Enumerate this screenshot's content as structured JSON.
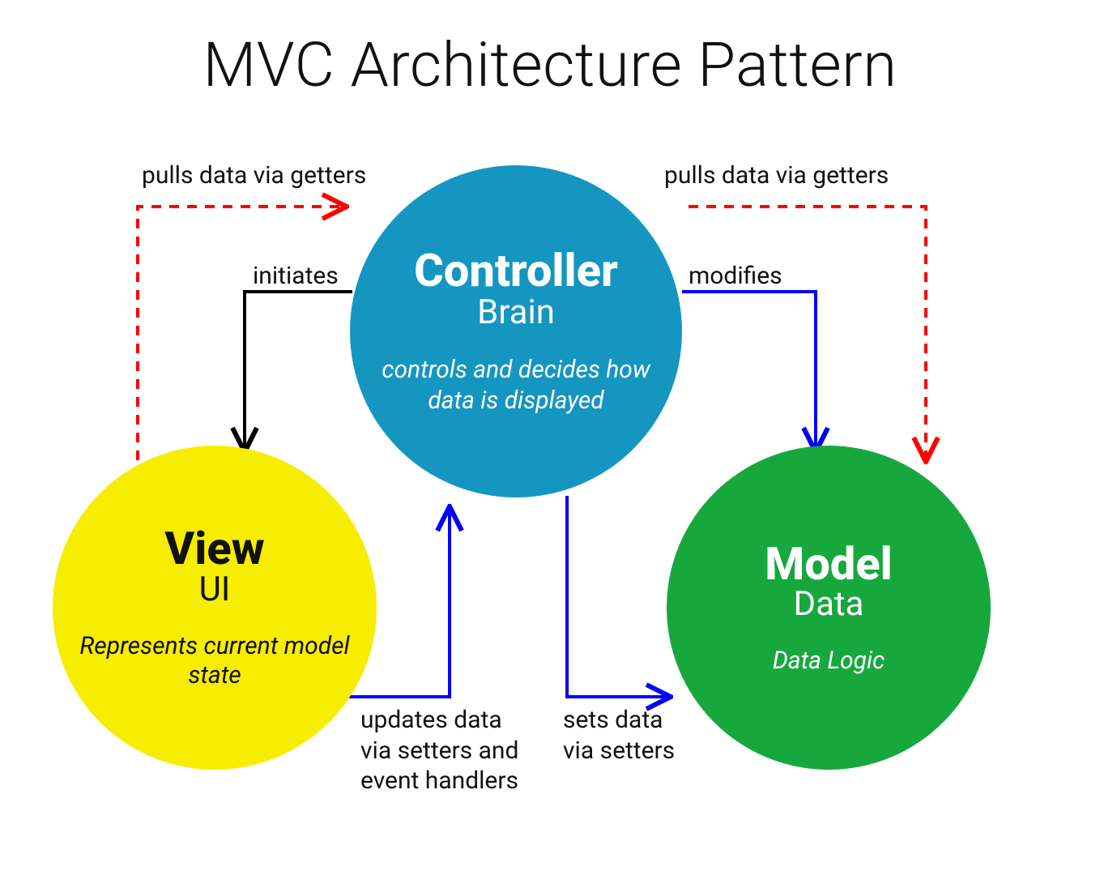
{
  "title": "MVC Architecture Pattern",
  "nodes": {
    "controller": {
      "name": "Controller",
      "sub": "Brain",
      "desc": "controls and decides how data is displayed"
    },
    "view": {
      "name": "View",
      "sub": "UI",
      "desc": "Represents current model state"
    },
    "model": {
      "name": "Model",
      "sub": "Data",
      "desc": "Data Logic"
    }
  },
  "edges": {
    "pulls_left": "pulls data via getters",
    "pulls_right": "pulls data via getters",
    "initiates": "initiates",
    "modifies": "modifies",
    "updates": "updates data via setters and event handlers",
    "sets": "sets data via setters"
  },
  "colors": {
    "controller": "#1596c0",
    "view": "#f6ed00",
    "model": "#17a83d",
    "arrow_black": "#000000",
    "arrow_blue": "#0000ff",
    "arrow_red": "#ff0000"
  }
}
